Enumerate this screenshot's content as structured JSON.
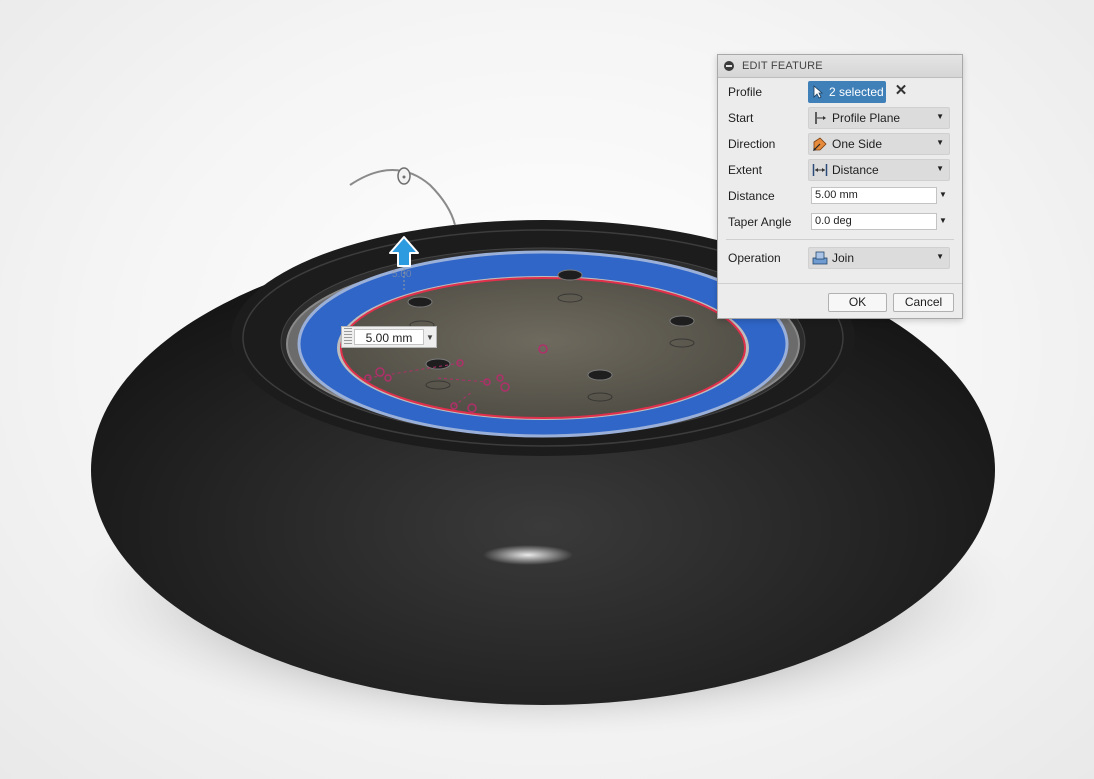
{
  "viewport": {
    "dimension_value": "5.00 mm",
    "ghost_value": "5.00"
  },
  "dialog": {
    "title": "EDIT FEATURE",
    "profile": {
      "label": "Profile",
      "value": "2 selected"
    },
    "start": {
      "label": "Start",
      "value": "Profile Plane",
      "icon": "profile-plane-icon"
    },
    "direction": {
      "label": "Direction",
      "value": "One Side",
      "icon": "one-side-icon"
    },
    "extent": {
      "label": "Extent",
      "value": "Distance",
      "icon": "distance-icon"
    },
    "distance": {
      "label": "Distance",
      "value": "5.00 mm"
    },
    "taper_angle": {
      "label": "Taper Angle",
      "value": "0.0 deg"
    },
    "operation": {
      "label": "Operation",
      "value": "Join",
      "icon": "join-icon"
    },
    "ok_label": "OK",
    "cancel_label": "Cancel"
  },
  "colors": {
    "selection_blue": "#3f80b9",
    "profile_blue": "#2f66c8",
    "profile_edge_red": "#e0304c",
    "tire": "#262626"
  }
}
